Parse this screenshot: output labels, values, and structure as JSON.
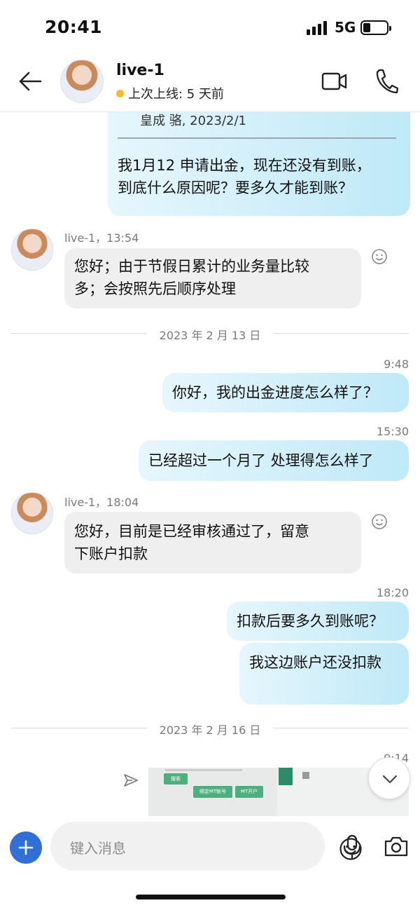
{
  "status_bar": {
    "time": "20:41",
    "network": "5G"
  },
  "header": {
    "title": "live-1",
    "presence": "上次上线: 5 天前"
  },
  "messages": {
    "m1": {
      "quote_author": "皇成 骆, 2023/2/1",
      "line1": "我1月12 申请出金，现在还没有到账，",
      "line2": "到底什么原因呢？要多久才能到账？"
    },
    "m2": {
      "meta": "live-1，13:54",
      "line1": "您好；由于节假日累计的业务量比较",
      "line2": "多；会按照先后顺序处理"
    },
    "date1": "2023 年 2 月 13 日",
    "m3": {
      "time": "9:48",
      "text": "你好，我的出金进度怎么样了？"
    },
    "m4": {
      "time": "15:30",
      "text": "已经超过一个月了 处理得怎么样了"
    },
    "m5": {
      "meta": "live-1，18:04",
      "line1": "您好，目前是已经审核通过了，留意",
      "line2": "下账户扣款"
    },
    "m6": {
      "time": "18:20",
      "text": "扣款后要多久到账呢？"
    },
    "m7": {
      "text": "我这边账户还没扣款"
    },
    "date2": "2023 年 2 月 16 日",
    "m8": {
      "time": "9:14",
      "img_search": "搜索",
      "img_btn1": "绑定MT帐号",
      "img_btn2": "MT开户"
    }
  },
  "input": {
    "placeholder": "键入消息"
  },
  "colors": {
    "accent": "#2f6fd6",
    "presence": "#f5b82e",
    "outgoing_bubble": "#bfe9f7",
    "incoming_bubble": "#efefef"
  }
}
